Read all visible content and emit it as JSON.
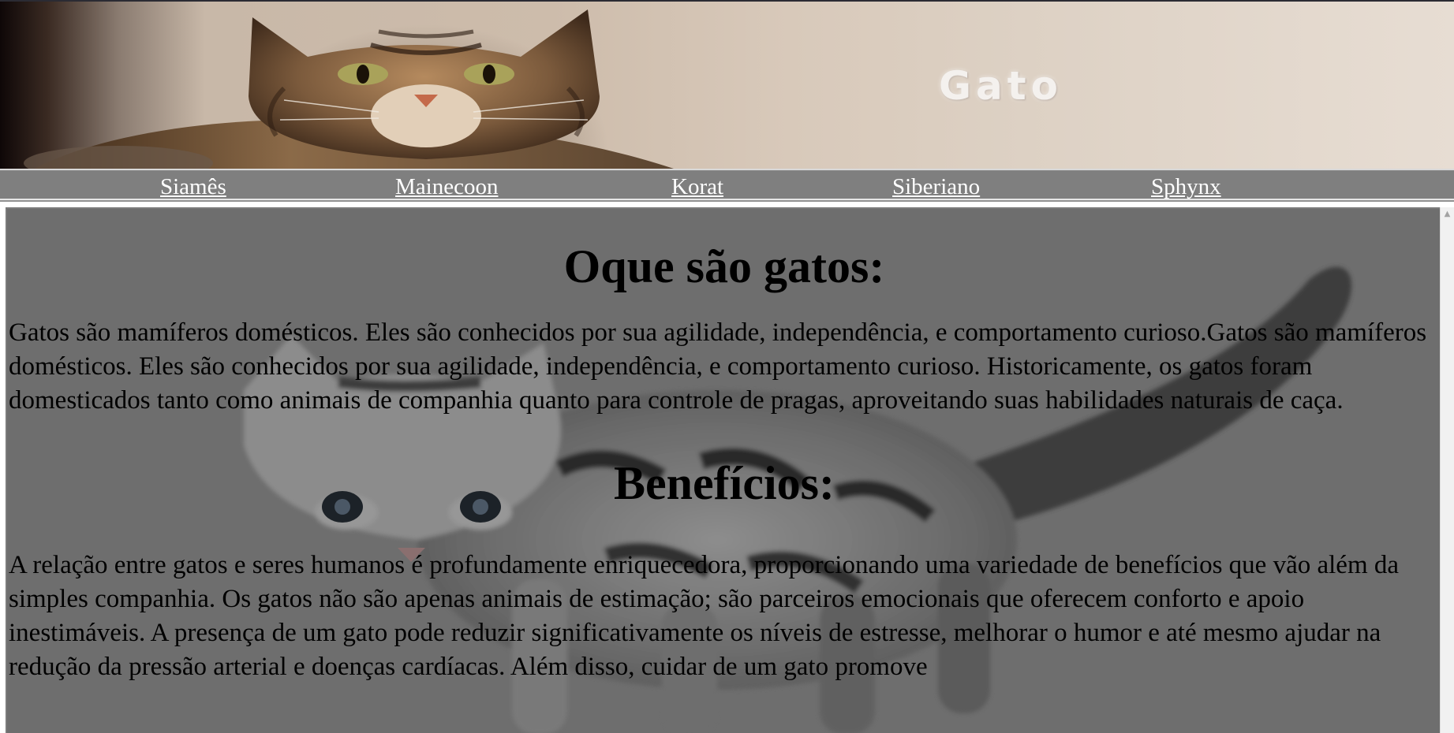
{
  "banner": {
    "title": "Gato"
  },
  "nav": {
    "items": [
      {
        "label": "Siamês"
      },
      {
        "label": "Mainecoon"
      },
      {
        "label": "Korat"
      },
      {
        "label": "Siberiano"
      },
      {
        "label": "Sphynx"
      }
    ]
  },
  "content": {
    "sections": [
      {
        "heading": "Oque são gatos:",
        "paragraph": "Gatos são mamíferos domésticos. Eles são conhecidos por sua agilidade, independência, e comportamento curioso.Gatos são mamíferos domésticos. Eles são conhecidos por sua agilidade, independência, e comportamento curioso. Historicamente, os gatos foram domesticados tanto como animais de companhia quanto para controle de pragas, aproveitando suas habilidades naturais de caça."
      },
      {
        "heading": "Benefícios:",
        "paragraph": "A relação entre gatos e seres humanos é profundamente enriquecedora, proporcionando uma variedade de benefícios que vão além da simples companhia. Os gatos não são apenas animais de estimação; são parceiros emocionais que oferecem conforto e apoio inestimáveis. A presença de um gato pode reduzir significativamente os níveis de estresse, melhorar o humor e até mesmo ajudar na redução da pressão arterial e doenças cardíacas. Além disso, cuidar de um gato promove"
      }
    ]
  },
  "colors": {
    "nav_background": "#7f7f7f",
    "content_background": "#6e6e6e",
    "link_color": "#ffffff"
  }
}
